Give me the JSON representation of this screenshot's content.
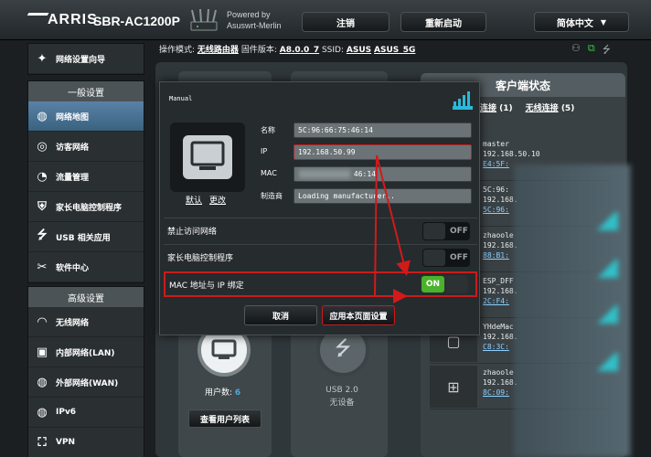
{
  "header": {
    "brand": "ARRIS",
    "model": "SBR-AC1200P",
    "powered_by": "Powered by",
    "powered_name": "Asuswrt-Merlin",
    "logout": "注销",
    "reboot": "重新启动",
    "language": "简体中文"
  },
  "infobar": {
    "mode_label": "操作模式:",
    "mode_value": "无线路由器",
    "fw_label": "固件版本:",
    "fw_value": "A8.0.0_7",
    "ssid_label": "SSID:",
    "ssid_1": "ASUS",
    "ssid_2": "ASUS_5G"
  },
  "sidebar": {
    "wizard": "网络设置向导",
    "general_header": "一般设置",
    "general_items": [
      "网络地图",
      "访客网络",
      "流量管理",
      "家长电脑控制程序",
      "USB 相关应用",
      "软件中心"
    ],
    "advanced_header": "高级设置",
    "advanced_items": [
      "无线网络",
      "内部网络(LAN)",
      "外部网络(WAN)",
      "IPv6",
      "VPN"
    ]
  },
  "map": {
    "client_status_title": "客户端状态",
    "tab_wired": "线连接",
    "tab_wired_count": "(1)",
    "tab_wireless": "无线连接",
    "tab_wireless_count": "(5)",
    "clients": [
      {
        "name": "master",
        "ip": "192.168.50.10",
        "mac": "E4:5F:"
      },
      {
        "name": "5C:96:",
        "ip": "192.168.",
        "mac": "5C:96:"
      },
      {
        "name": "zhaoole",
        "ip": "192.168.",
        "mac": "88:B1:"
      },
      {
        "name": "ESP_DFF",
        "ip": "192.168.",
        "mac": "2C:F4:"
      },
      {
        "name": "YHdeMac",
        "ip": "192.168.",
        "mac": "C8:3C:"
      },
      {
        "name": "zhaoole",
        "ip": "192.168.",
        "mac": "8C:09:"
      }
    ],
    "user_count_label": "用户数:",
    "user_count": "6",
    "view_list": "查看用户列表",
    "usb_label": "USB 2.0",
    "usb_status": "无设备"
  },
  "modal": {
    "title": "Manual",
    "default_link": "默认",
    "change_link": "更改",
    "name_label": "名称",
    "name_value": "5C:96:66:75:46:14",
    "ip_label": "IP",
    "ip_value": "192.168.50.99",
    "mac_label": "MAC",
    "mac_value": "46:14",
    "vendor_label": "制造商",
    "vendor_value": "Loading manufacturer..",
    "block_label": "禁止访问网络",
    "block_state": "OFF",
    "parental_label": "家长电脑控制程序",
    "parental_state": "OFF",
    "bind_label": "MAC 地址与 IP 绑定",
    "bind_state": "ON",
    "cancel": "取消",
    "apply": "应用本页面设置"
  }
}
